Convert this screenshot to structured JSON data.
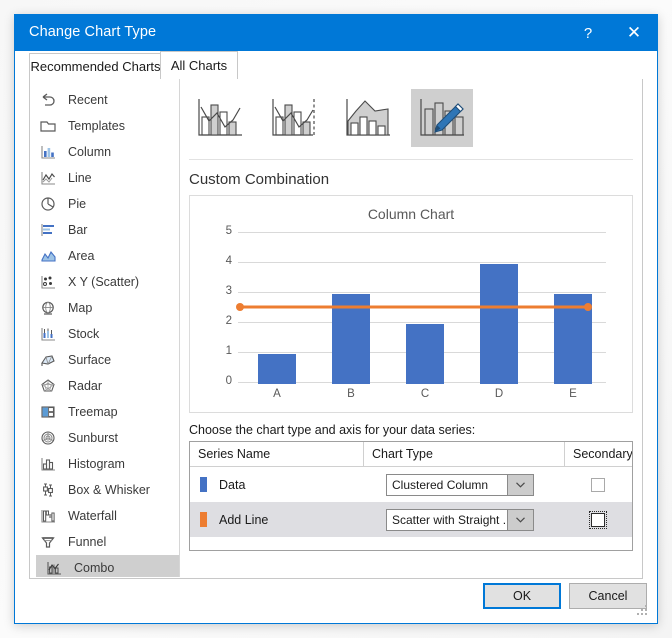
{
  "window": {
    "title": "Change Chart Type",
    "help_label": "?",
    "close_label": "✕"
  },
  "tabs": [
    {
      "label": "Recommended Charts",
      "active": false
    },
    {
      "label": "All Charts",
      "active": true
    }
  ],
  "sidebar": {
    "items": [
      {
        "label": "Recent",
        "icon": "recent-icon"
      },
      {
        "label": "Templates",
        "icon": "templates-icon"
      },
      {
        "label": "Column",
        "icon": "column-icon"
      },
      {
        "label": "Line",
        "icon": "line-icon"
      },
      {
        "label": "Pie",
        "icon": "pie-icon"
      },
      {
        "label": "Bar",
        "icon": "bar-icon"
      },
      {
        "label": "Area",
        "icon": "area-icon"
      },
      {
        "label": "X Y (Scatter)",
        "icon": "scatter-icon"
      },
      {
        "label": "Map",
        "icon": "map-icon"
      },
      {
        "label": "Stock",
        "icon": "stock-icon"
      },
      {
        "label": "Surface",
        "icon": "surface-icon"
      },
      {
        "label": "Radar",
        "icon": "radar-icon"
      },
      {
        "label": "Treemap",
        "icon": "treemap-icon"
      },
      {
        "label": "Sunburst",
        "icon": "sunburst-icon"
      },
      {
        "label": "Histogram",
        "icon": "histogram-icon"
      },
      {
        "label": "Box & Whisker",
        "icon": "box-whisker-icon"
      },
      {
        "label": "Waterfall",
        "icon": "waterfall-icon"
      },
      {
        "label": "Funnel",
        "icon": "funnel-icon"
      },
      {
        "label": "Combo",
        "icon": "combo-icon",
        "selected": true
      }
    ]
  },
  "thumbnails": [
    {
      "name": "clustered-column-line",
      "selected": false
    },
    {
      "name": "clustered-column-line-secondary",
      "selected": false
    },
    {
      "name": "stacked-area-clustered-column",
      "selected": false
    },
    {
      "name": "custom-combination",
      "selected": true
    }
  ],
  "main": {
    "combo_title": "Custom Combination",
    "choose_label": "Choose the chart type and axis for your data series:"
  },
  "chart_data": {
    "type": "bar",
    "title": "Column Chart",
    "xlabel": "",
    "ylabel": "",
    "categories": [
      "A",
      "B",
      "C",
      "D",
      "E"
    ],
    "ylim": [
      0,
      5
    ],
    "yticks": [
      0,
      1,
      2,
      3,
      4,
      5
    ],
    "grid": true,
    "legend": "none",
    "series": [
      {
        "name": "Data",
        "type": "bar",
        "values": [
          1,
          3,
          2,
          4,
          3
        ],
        "color": "#4472c4"
      },
      {
        "name": "Add Line",
        "type": "scatter-straight-line",
        "values": [
          2.5,
          2.5
        ],
        "x": [
          0,
          5
        ],
        "color": "#ed7d31",
        "markers": true
      }
    ]
  },
  "series_table": {
    "headers": {
      "series_name": "Series Name",
      "chart_type": "Chart Type",
      "secondary_axis": "Secondary Axis"
    },
    "rows": [
      {
        "series_name": "Data",
        "color": "#4472c4",
        "chart_type": "Clustered Column",
        "secondary_axis_checked": false,
        "selected": false,
        "focused": false
      },
      {
        "series_name": "Add Line",
        "color": "#ed7d31",
        "chart_type": "Scatter with Straight ...",
        "secondary_axis_checked": false,
        "selected": true,
        "focused": true
      }
    ]
  },
  "footer": {
    "ok_label": "OK",
    "cancel_label": "Cancel"
  },
  "colors": {
    "titlebar": "#0078D7",
    "accent": "#0078D7",
    "series_data": "#4472C4",
    "series_line": "#ED7D31",
    "selection": "#CFCFCF"
  }
}
